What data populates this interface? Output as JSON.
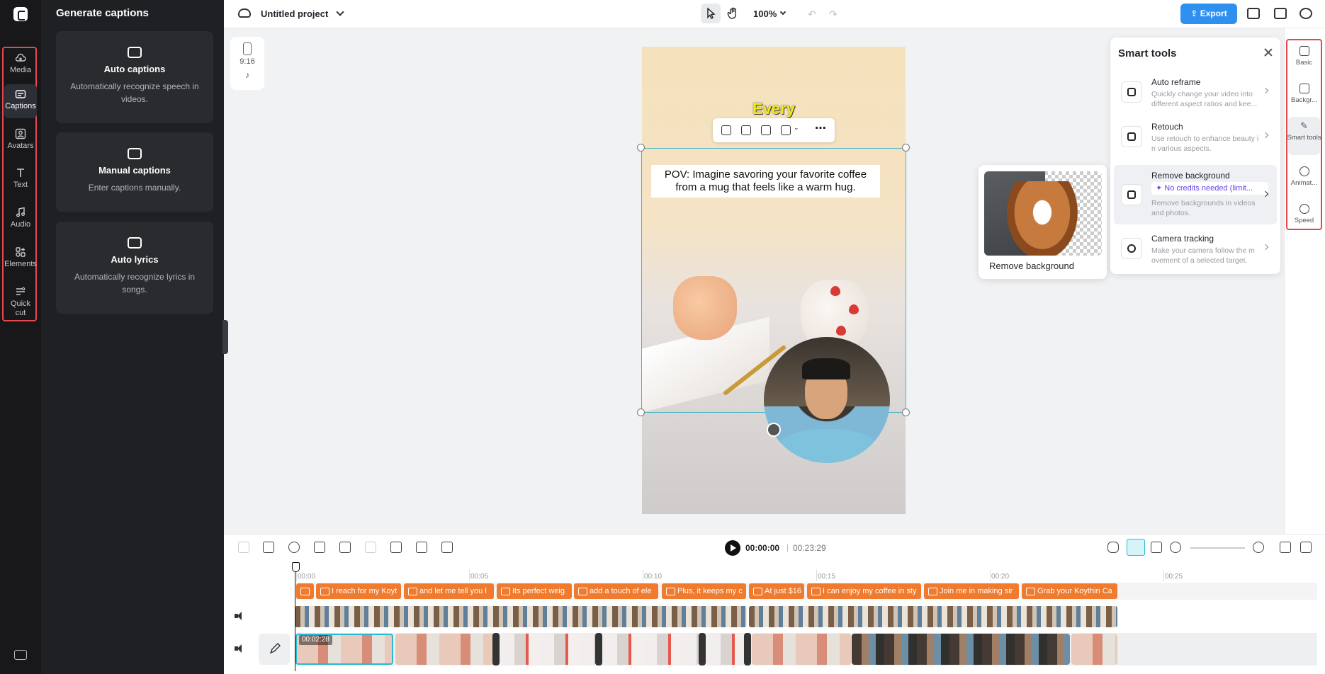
{
  "nav": {
    "items": [
      {
        "label": "Media",
        "icon": "cloud-upload-icon"
      },
      {
        "label": "Captions",
        "icon": "captions-icon"
      },
      {
        "label": "Avatars",
        "icon": "avatar-icon"
      },
      {
        "label": "Text",
        "icon": "text-icon"
      },
      {
        "label": "Audio",
        "icon": "music-icon"
      },
      {
        "label": "Elements",
        "icon": "elements-icon"
      },
      {
        "label": "Quick cut",
        "icon": "quick-cut-icon"
      }
    ]
  },
  "panel": {
    "title": "Generate captions",
    "cards": [
      {
        "title": "Auto captions",
        "desc": "Automatically recognize speech in videos."
      },
      {
        "title": "Manual captions",
        "desc": "Enter captions manually."
      },
      {
        "title": "Auto lyrics",
        "desc": "Automatically recognize lyrics in songs."
      }
    ]
  },
  "topbar": {
    "project_title": "Untitled project",
    "zoom": "100%",
    "export_label": "Export"
  },
  "canvas": {
    "ratio": "9:16",
    "overlay_word": "Every",
    "caption_text": "POV: Imagine savoring your favorite coffee from a mug that feels like a warm hug."
  },
  "preview": {
    "label": "Remove background"
  },
  "smart_tools": {
    "title": "Smart tools",
    "items": [
      {
        "name": "Auto reframe",
        "desc1": "Quickly change your video into",
        "desc2": "different aspect ratios and kee..."
      },
      {
        "name": "Retouch",
        "desc1": "Use retouch to enhance beauty i",
        "desc2": "n various aspects."
      },
      {
        "name": "Remove background",
        "badge": "✦ No credits needed (limit...",
        "desc1": "Remove backgrounds in videos",
        "desc2": "and photos."
      },
      {
        "name": "Camera tracking",
        "desc1": "Make your camera follow the m",
        "desc2": "ovement of a selected target."
      }
    ]
  },
  "right_rail": {
    "items": [
      {
        "label": "Basic",
        "icon": "basic-icon"
      },
      {
        "label": "Backgr...",
        "icon": "background-icon"
      },
      {
        "label": "Smart tools",
        "icon": "magic-wand-icon"
      },
      {
        "label": "Animat...",
        "icon": "animation-icon"
      },
      {
        "label": "Speed",
        "icon": "speed-icon"
      }
    ]
  },
  "timeline": {
    "current_time": "00:00:00",
    "separator": "|",
    "total_time": "00:23:29",
    "ruler": [
      "00:00",
      "00:05",
      "00:10",
      "00:15",
      "00:20",
      "00:25"
    ],
    "caption_clips": [
      "",
      "I reach for my Koyt",
      "and let me tell you l",
      "Its perfect weig",
      "add a touch of ele",
      "Plus, it keeps my c",
      "At just $16",
      "I can enjoy my coffee in sty",
      "Join me in making sir",
      "Grab your Koythin Ca"
    ],
    "selected_clip_time": "00:02:28"
  },
  "colors": {
    "accent": "#2f90ef",
    "caption_clip": "#f07a2d",
    "selection": "#2bb8d4",
    "highlight_border": "#e5484d"
  }
}
